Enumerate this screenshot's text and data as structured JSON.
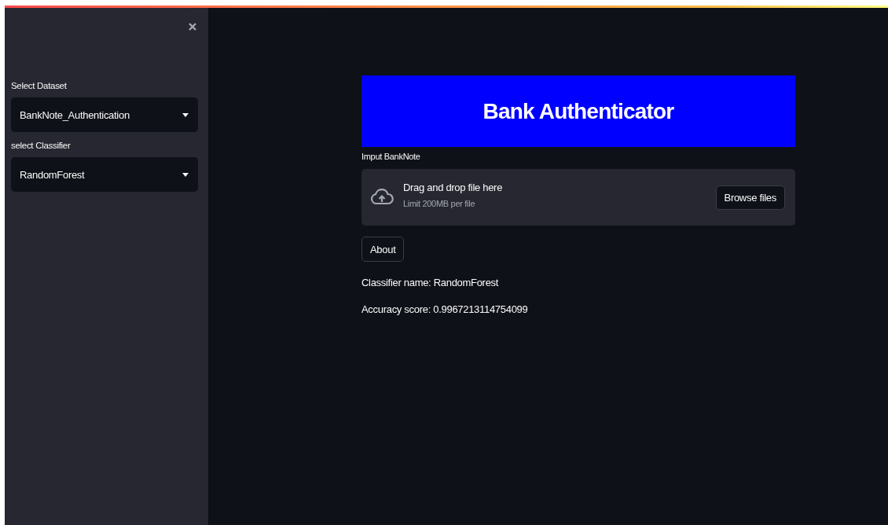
{
  "sidebar": {
    "selects": [
      {
        "label": "Select Dataset",
        "value": "BankNote_Authentication"
      },
      {
        "label": "select Classifier",
        "value": "RandomForest"
      }
    ]
  },
  "main": {
    "title": "Bank Authenticator",
    "uploader": {
      "label": "Imput BankNote",
      "prompt": "Drag and drop file here",
      "limit": "Limit 200MB per file",
      "button": "Browse files"
    },
    "about_button": "About",
    "lines": [
      "Classifier name: RandomForest",
      "Accuracy score: 0.9967213114754099"
    ]
  }
}
